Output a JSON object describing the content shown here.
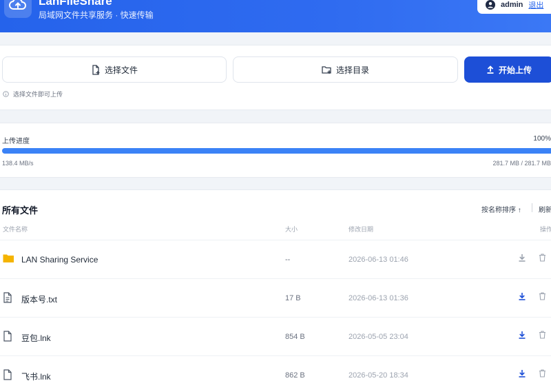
{
  "header": {
    "title": "LanFileShare",
    "subtitle": "局域网文件共享服务 · 快速传输",
    "username": "admin",
    "logout_label": "退出",
    "logo_icon": "cloud-upload-icon",
    "user_icon": "user-circle-icon"
  },
  "upload": {
    "select_file_label": "选择文件",
    "select_dir_label": "选择目录",
    "start_upload_label": "开始上传",
    "hint": "选择文件即可上传"
  },
  "progress": {
    "label": "上传进度",
    "percent_text": "100%",
    "percent_value": 100,
    "speed": "138.4 MB/s",
    "size": "281.7 MB / 281.7 MB"
  },
  "files": {
    "title": "所有文件",
    "sort_label": "按名称排序 ↑",
    "refresh_label": "刷新",
    "columns": {
      "name": "文件名称",
      "size": "大小",
      "date": "修改日期",
      "ops": "操作"
    },
    "rows": [
      {
        "name": "LAN Sharing Service",
        "size": "--",
        "date": "2026-06-13 01:46",
        "type": "folder-icon"
      },
      {
        "name": "版本号.txt",
        "size": "17 B",
        "date": "2026-06-13 01:36",
        "type": "text-file-icon"
      },
      {
        "name": "豆包.lnk",
        "size": "854 B",
        "date": "2026-05-05 23:04",
        "type": "file-icon"
      },
      {
        "name": "飞书.lnk",
        "size": "862 B",
        "date": "2026-05-20 18:34",
        "type": "file-icon"
      }
    ]
  },
  "colors": {
    "header_blue": "#2563eb",
    "primary_button": "#1d4fd7",
    "progress_fill": "#3b82f6",
    "folder": "#f5b400"
  }
}
